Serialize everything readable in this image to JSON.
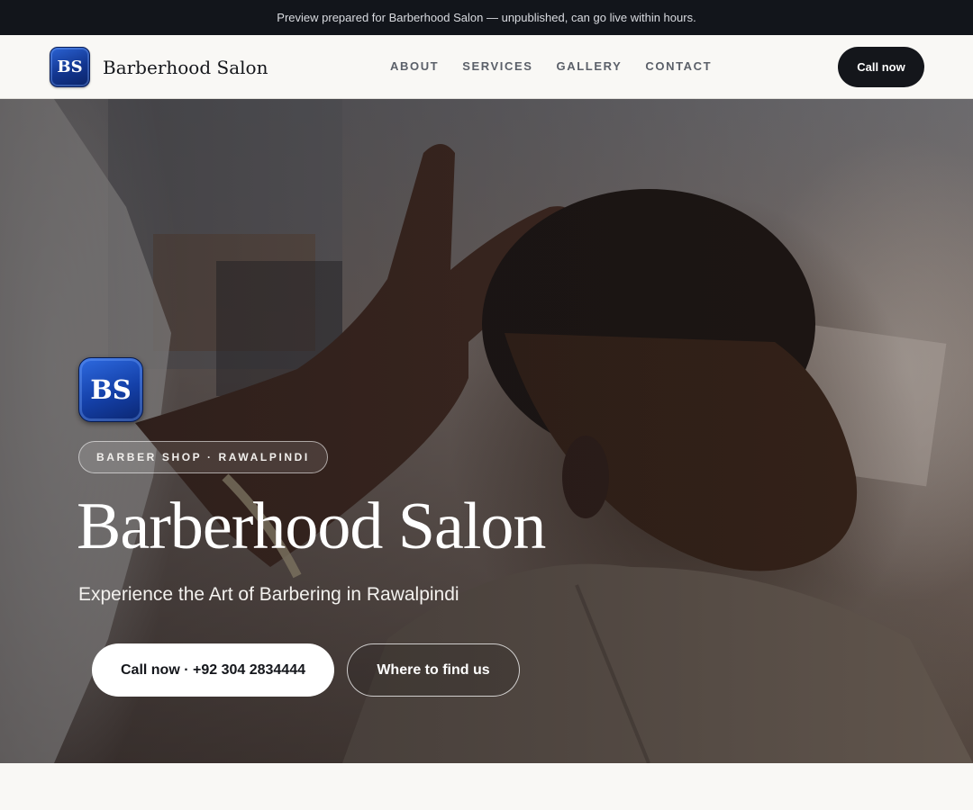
{
  "preview_bar": {
    "text": "Preview prepared for Barberhood Salon — unpublished, can go live within hours."
  },
  "header": {
    "logo_text": "BS",
    "brand_name": "Barberhood Salon",
    "nav": [
      "ABOUT",
      "SERVICES",
      "GALLERY",
      "CONTACT"
    ],
    "cta_label": "Call now"
  },
  "hero": {
    "logo_text": "BS",
    "badge": "BARBER SHOP · RAWALPINDI",
    "title": "Barberhood Salon",
    "subtitle": "Experience the Art of Barbering in Rawalpindi",
    "primary_button": "Call now · +92 304 2834444",
    "secondary_button": "Where to find us"
  },
  "colors": {
    "preview_bar_bg": "#12151b",
    "logo_blue": "#1440a8",
    "dark_button": "#14161b",
    "page_bg": "#f9f8f5"
  }
}
